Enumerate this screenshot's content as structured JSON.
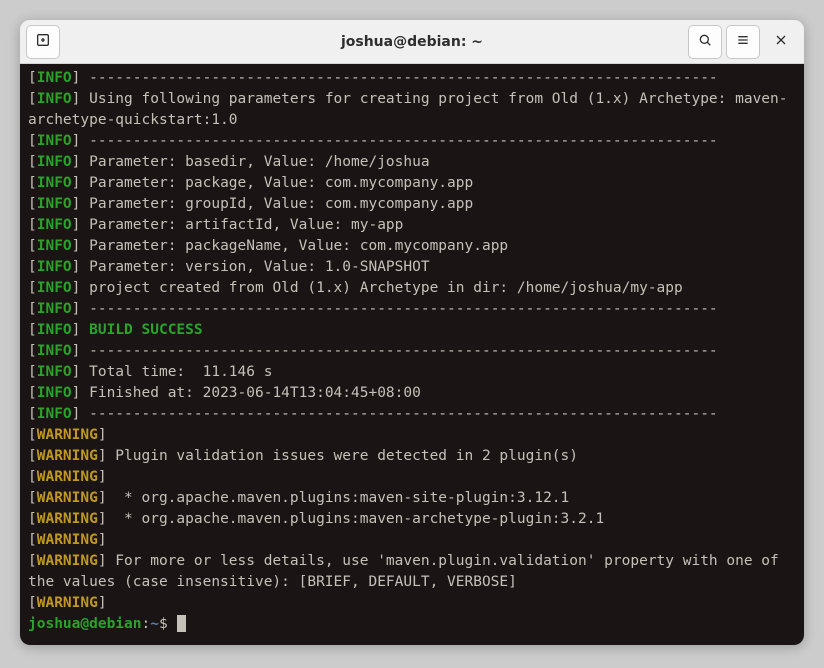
{
  "window": {
    "title": "joshua@debian: ~"
  },
  "prompt": {
    "userhost": "joshua@debian",
    "path": "~",
    "symbol": "$"
  },
  "icons": {
    "newtab": "new-tab-icon",
    "search": "search-icon",
    "menu": "hamburger-menu-icon",
    "close": "close-icon"
  },
  "dash_rule": "------------------------------------------------------------------------",
  "log": [
    {
      "level": "INFO",
      "text": " "
    },
    {
      "level": "INFO",
      "text": " Using following parameters for creating project from Old (1.x) Archetype: maven-archetype-quickstart:1.0"
    },
    {
      "level": "INFO",
      "text": " "
    },
    {
      "level": "INFO",
      "text": " Parameter: basedir, Value: /home/joshua"
    },
    {
      "level": "INFO",
      "text": " Parameter: package, Value: com.mycompany.app"
    },
    {
      "level": "INFO",
      "text": " Parameter: groupId, Value: com.mycompany.app"
    },
    {
      "level": "INFO",
      "text": " Parameter: artifactId, Value: my-app"
    },
    {
      "level": "INFO",
      "text": " Parameter: packageName, Value: com.mycompany.app"
    },
    {
      "level": "INFO",
      "text": " Parameter: version, Value: 1.0-SNAPSHOT"
    },
    {
      "level": "INFO",
      "text": " project created from Old (1.x) Archetype in dir: /home/joshua/my-app"
    },
    {
      "level": "INFO",
      "text": " "
    },
    {
      "level": "INFO",
      "build_success": true,
      "text": " "
    },
    {
      "level": "INFO",
      "text": " "
    },
    {
      "level": "INFO",
      "text": " Total time:  11.146 s"
    },
    {
      "level": "INFO",
      "text": " Finished at: 2023-06-14T13:04:45+08:00"
    },
    {
      "level": "INFO",
      "text": " "
    },
    {
      "level": "WARNING",
      "text": " "
    },
    {
      "level": "WARNING",
      "text": " Plugin validation issues were detected in 2 plugin(s)"
    },
    {
      "level": "WARNING",
      "text": " "
    },
    {
      "level": "WARNING",
      "text": "  * org.apache.maven.plugins:maven-site-plugin:3.12.1"
    },
    {
      "level": "WARNING",
      "text": "  * org.apache.maven.plugins:maven-archetype-plugin:3.2.1"
    },
    {
      "level": "WARNING",
      "text": " "
    },
    {
      "level": "WARNING",
      "text": " For more or less details, use 'maven.plugin.validation' property with one of the values (case insensitive): [BRIEF, DEFAULT, VERBOSE]"
    },
    {
      "level": "WARNING",
      "text": " "
    }
  ],
  "build_success_label": "BUILD SUCCESS",
  "dash_indices": [
    0,
    2,
    10,
    12,
    15
  ],
  "colors": {
    "terminal_bg": "#1a1414",
    "fg": "#c5c0b8",
    "info_green": "#29a329",
    "warning_yellow": "#c09820",
    "prompt_path_blue": "#5a7ab0"
  }
}
